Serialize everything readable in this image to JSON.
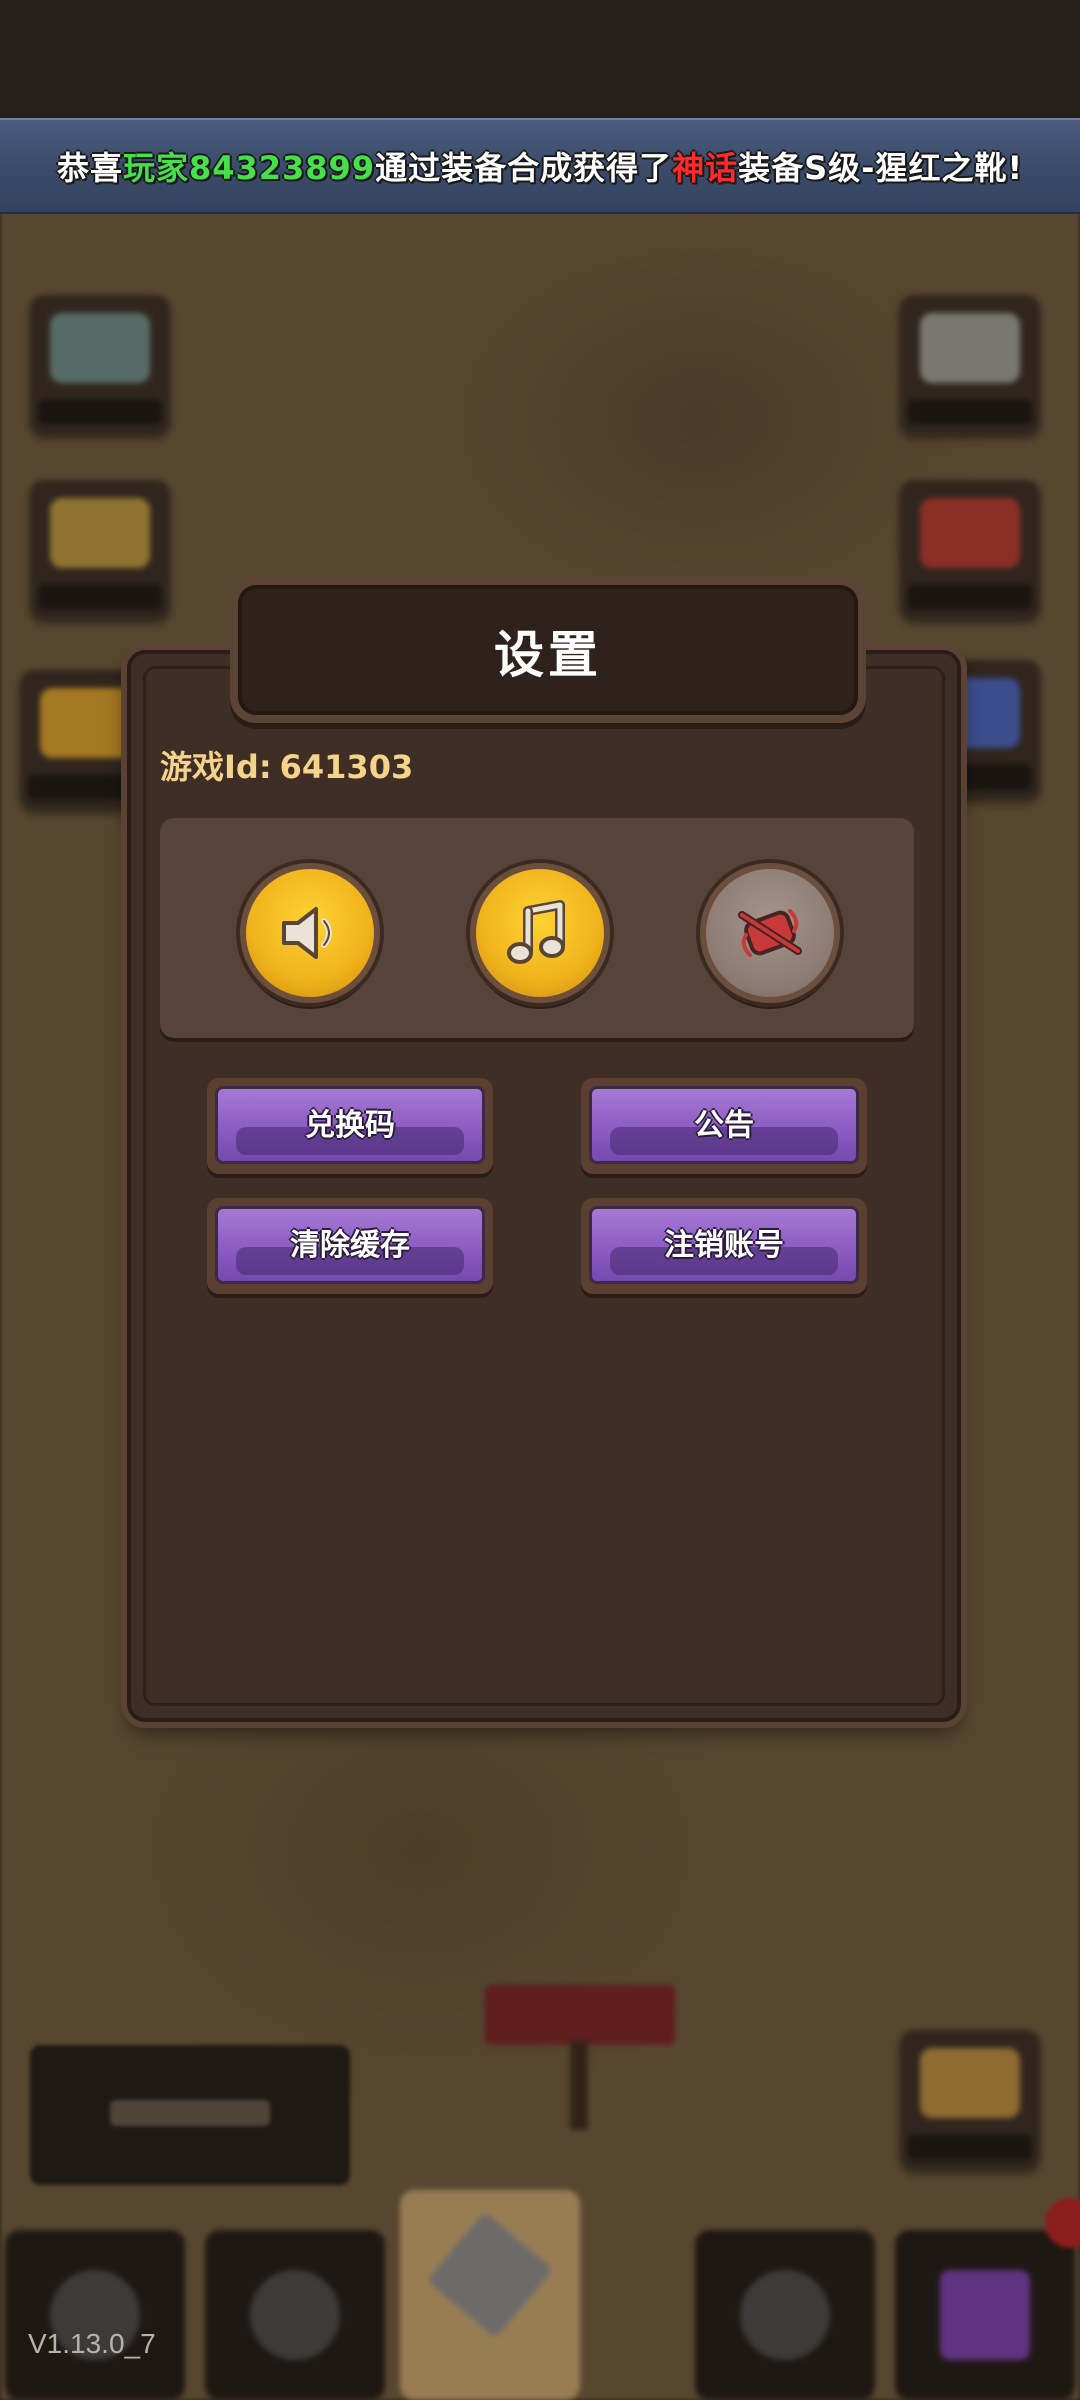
{
  "ticker": {
    "prefix": "恭喜",
    "player": "玩家84323899",
    "middle": "通过装备合成获得了",
    "rarity": "神话",
    "suffix": "装备S级-猩红之靴!"
  },
  "dialog": {
    "title": "设置",
    "game_id_label": "游戏Id:",
    "game_id_value": "641303",
    "toggles": [
      {
        "icon": "sound-icon",
        "state": "on"
      },
      {
        "icon": "music-icon",
        "state": "on"
      },
      {
        "icon": "vibration-off-icon",
        "state": "off"
      }
    ],
    "buttons": {
      "redeem": "兑换码",
      "announcement": "公告",
      "clear_cache": "清除缓存",
      "delete_account": "注销账号"
    }
  },
  "version": "V1.13.0_7",
  "colors": {
    "player_highlight": "#46e04a",
    "rarity_highlight": "#ff2a2a",
    "button_purple": "#8c5cc2",
    "toggle_gold": "#f0b31b",
    "game_id_text": "#f4d38b"
  }
}
